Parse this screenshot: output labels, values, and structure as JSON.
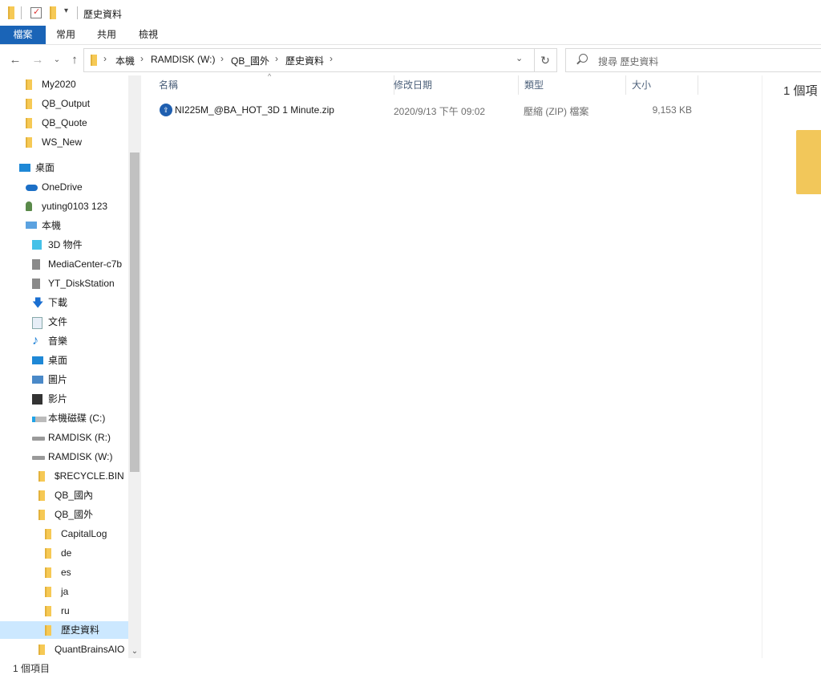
{
  "window": {
    "title": "歷史資料"
  },
  "ribbon": {
    "tabs": [
      "檔案",
      "常用",
      "共用",
      "檢視"
    ]
  },
  "address": {
    "crumbs": [
      "本機",
      "RAMDISK (W:)",
      "QB_國外",
      "歷史資料"
    ]
  },
  "search": {
    "placeholder": "搜尋 歷史資料"
  },
  "sidebar": {
    "items": [
      {
        "label": "My2020",
        "icon": "folder-icon"
      },
      {
        "label": "QB_Output",
        "icon": "folder-icon"
      },
      {
        "label": "QB_Quote",
        "icon": "folder-icon"
      },
      {
        "label": "WS_New",
        "icon": "folder-icon"
      },
      {
        "label": "桌面",
        "icon": "desktop-icon"
      },
      {
        "label": "OneDrive",
        "icon": "cloud-icon"
      },
      {
        "label": "yuting0103 123",
        "icon": "user-icon"
      },
      {
        "label": "本機",
        "icon": "computer-icon"
      },
      {
        "label": "3D 物件",
        "icon": "cube-icon"
      },
      {
        "label": "MediaCenter-c7b",
        "icon": "network-drive-icon"
      },
      {
        "label": "YT_DiskStation",
        "icon": "network-drive-icon"
      },
      {
        "label": "下載",
        "icon": "download-icon"
      },
      {
        "label": "文件",
        "icon": "document-icon"
      },
      {
        "label": "音樂",
        "icon": "music-icon"
      },
      {
        "label": "桌面",
        "icon": "desktop-icon"
      },
      {
        "label": "圖片",
        "icon": "picture-icon"
      },
      {
        "label": "影片",
        "icon": "video-icon"
      },
      {
        "label": "本機磁碟 (C:)",
        "icon": "windows-drive-icon"
      },
      {
        "label": "RAMDISK (R:)",
        "icon": "drive-icon"
      },
      {
        "label": "RAMDISK (W:)",
        "icon": "drive-icon"
      },
      {
        "label": "$RECYCLE.BIN",
        "icon": "folder-icon"
      },
      {
        "label": "QB_國內",
        "icon": "folder-icon"
      },
      {
        "label": "QB_國外",
        "icon": "folder-icon"
      },
      {
        "label": "CapitalLog",
        "icon": "folder-icon"
      },
      {
        "label": "de",
        "icon": "folder-icon"
      },
      {
        "label": "es",
        "icon": "folder-icon"
      },
      {
        "label": "ja",
        "icon": "folder-icon"
      },
      {
        "label": "ru",
        "icon": "folder-icon"
      },
      {
        "label": "歷史資料",
        "icon": "folder-icon",
        "selected": true
      },
      {
        "label": "QuantBrainsAIO",
        "icon": "folder-icon"
      }
    ]
  },
  "list": {
    "columns": [
      "名稱",
      "修改日期",
      "類型",
      "大小"
    ],
    "rows": [
      {
        "name": "NI225M_@BA_HOT_3D 1 Minute.zip",
        "modified": "2020/9/13 下午 09:02",
        "type": "壓縮 (ZIP) 檔案",
        "size": "9,153 KB"
      }
    ]
  },
  "preview": {
    "count": "1 個項"
  },
  "status": {
    "text": "1 個項目"
  },
  "colors": {
    "accent": "#1a64b7",
    "selection": "#cce8ff",
    "folder": "#f6c955"
  }
}
